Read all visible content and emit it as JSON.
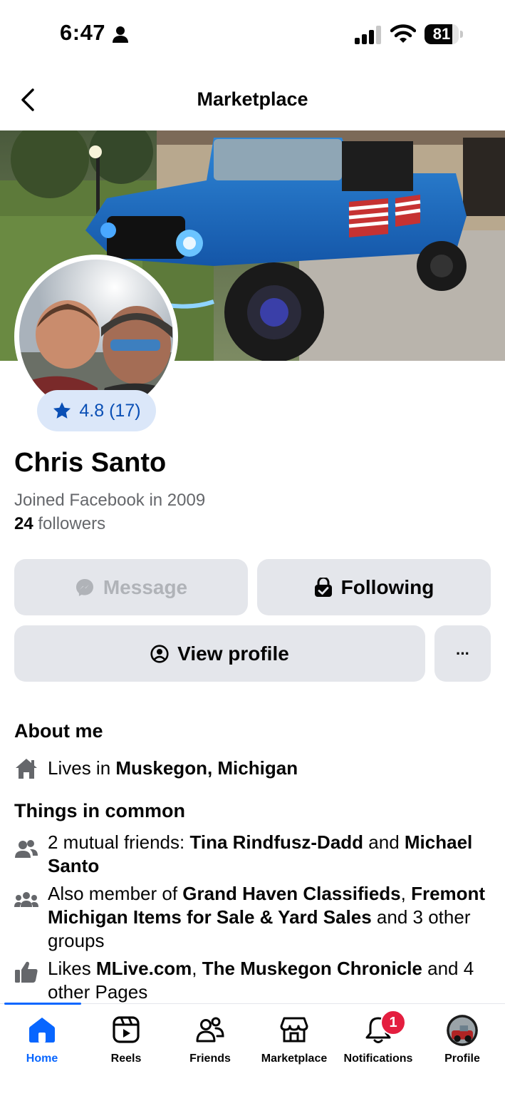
{
  "status_bar": {
    "time": "6:47",
    "battery": "81",
    "battery_level": 0.81
  },
  "header": {
    "title": "Marketplace"
  },
  "profile": {
    "rating": "4.8 (17)",
    "name": "Chris Santo",
    "joined": "Joined Facebook in 2009",
    "followers_count": "24",
    "followers_label": "followers"
  },
  "actions": {
    "message_label": "Message",
    "following_label": "Following",
    "view_profile_label": "View profile",
    "more_label": "···"
  },
  "about": {
    "title": "About me",
    "lives_prefix": "Lives in ",
    "lives_location": "Muskegon, Michigan"
  },
  "common": {
    "title": "Things in common",
    "friends_prefix": "2 mutual friends: ",
    "friend_1": "Tina Rindfusz-Dadd",
    "friends_and": " and ",
    "friend_2": "Michael Santo",
    "groups_prefix": "Also member of ",
    "group_1": "Grand Haven Classifieds",
    "groups_comma": ", ",
    "group_2": "Fremont Michigan Items for Sale & Yard Sales",
    "groups_suffix": " and 3 other groups",
    "likes_prefix": "Likes ",
    "page_1": "MLive.com",
    "likes_comma": ", ",
    "page_2": "The Muskegon Chronicle",
    "likes_suffix": " and 4 other Pages"
  },
  "tabbar": {
    "home": "Home",
    "reels": "Reels",
    "friends": "Friends",
    "marketplace": "Marketplace",
    "notifications": "Notifications",
    "notifications_badge": "1",
    "profile": "Profile"
  },
  "colors": {
    "accent": "#0866ff",
    "rating_text": "#0a4fb5",
    "rating_bg": "#dbe7f9",
    "button_bg": "#e4e6eb",
    "badge": "#e41e3f",
    "secondary_text": "#65676b"
  },
  "icons": {
    "back": "chevron-left-icon",
    "rating": "star-icon",
    "message": "messenger-icon",
    "following": "lock-check-icon",
    "view_profile": "user-circle-icon",
    "lives": "house-icon",
    "friends": "people-icon",
    "groups": "groups-icon",
    "likes": "thumbs-up-icon"
  }
}
